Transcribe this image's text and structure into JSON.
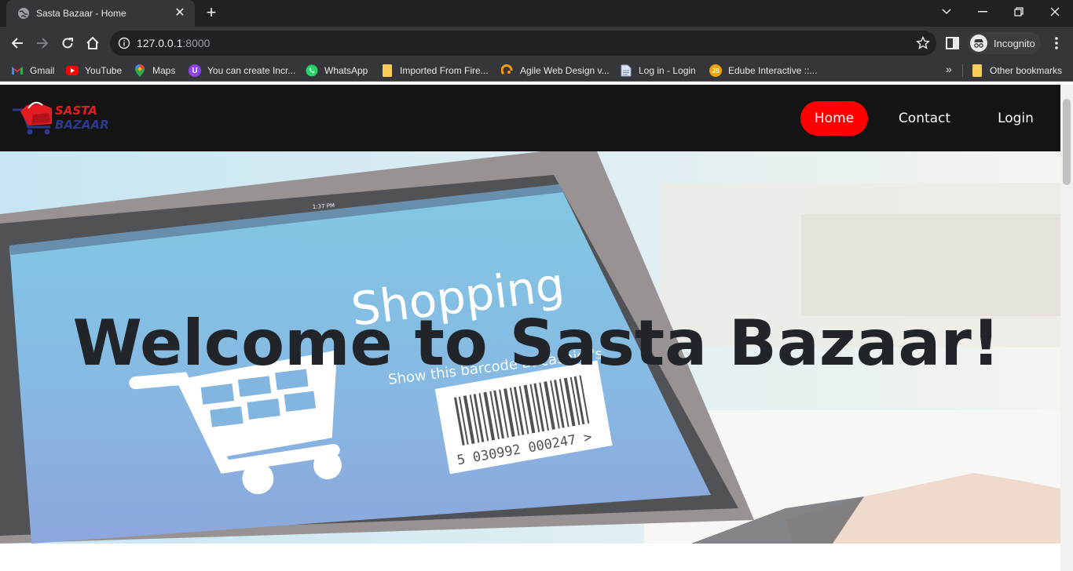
{
  "browser": {
    "tab_title": "Sasta Bazaar - Home",
    "url_host": "127.0.0.1",
    "url_port": ":8000",
    "profile_label": "Incognito",
    "bookmarks": [
      {
        "label": "Gmail",
        "icon": "gmail-icon"
      },
      {
        "label": "YouTube",
        "icon": "youtube-icon"
      },
      {
        "label": "Maps",
        "icon": "maps-icon"
      },
      {
        "label": "You can create Incr...",
        "icon": "purple-u-icon"
      },
      {
        "label": "WhatsApp",
        "icon": "whatsapp-icon"
      },
      {
        "label": "Imported From Fire...",
        "icon": "folder-icon"
      },
      {
        "label": "Agile Web Design v...",
        "icon": "agile-icon"
      },
      {
        "label": "Log in - Login",
        "icon": "page-icon"
      },
      {
        "label": "Edube Interactive ::...",
        "icon": "js-icon"
      }
    ],
    "other_bookmarks": "Other bookmarks"
  },
  "site": {
    "logo_line1": "SASTA",
    "logo_line2": "BAZAAR",
    "nav": {
      "home": "Home",
      "contact": "Contact",
      "login": "Login"
    },
    "hero_title": "Welcome to Sasta Bazaar!",
    "screen_text": "Shopping",
    "screen_subtext": "Show this barcode at cashier's",
    "barcode_number": "5 030992 000247 >",
    "screen_time": "1:37 PM"
  },
  "colors": {
    "nav_bg": "#141414",
    "active_pill": "#ff0000",
    "hero_text": "#212529"
  }
}
